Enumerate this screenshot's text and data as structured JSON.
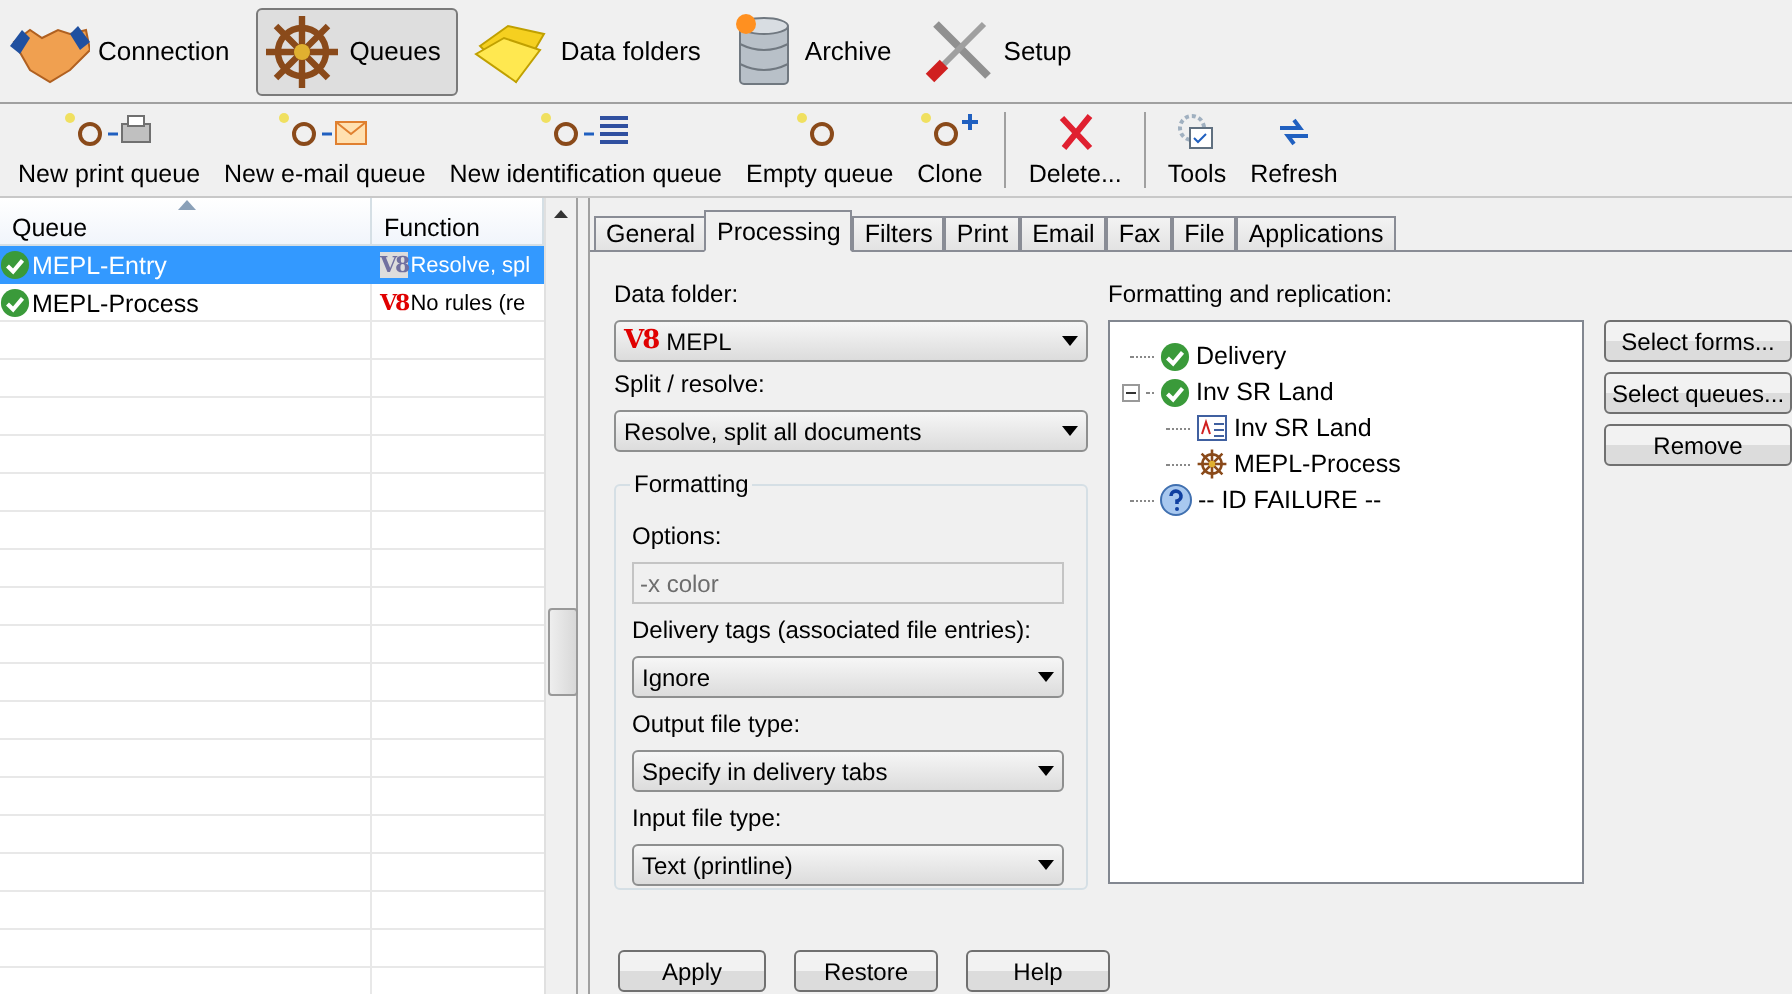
{
  "nav": [
    {
      "label": "Connection",
      "kind": "handshake",
      "selected": false
    },
    {
      "label": "Queues",
      "kind": "wheel",
      "selected": true
    },
    {
      "label": "Data folders",
      "kind": "folder",
      "selected": false
    },
    {
      "label": "Archive",
      "kind": "database",
      "selected": false
    },
    {
      "label": "Setup",
      "kind": "tools",
      "selected": false
    }
  ],
  "toolbar": [
    [
      {
        "label": "New print queue",
        "kind": "print"
      },
      {
        "label": "New e-mail queue",
        "kind": "email"
      },
      {
        "label": "New identification queue",
        "kind": "identify"
      },
      {
        "label": "Empty queue",
        "kind": "empty"
      },
      {
        "label": "Clone",
        "kind": "clone"
      }
    ],
    [
      {
        "label": "Delete...",
        "kind": "delete"
      }
    ],
    [
      {
        "label": "Tools",
        "kind": "settings"
      },
      {
        "label": "Refresh",
        "kind": "refresh"
      }
    ]
  ],
  "queue_table": {
    "columns": [
      {
        "label": "Queue",
        "sorted": true
      },
      {
        "label": "Function",
        "sorted": false
      }
    ],
    "rows": [
      {
        "name": "MEPL-Entry",
        "tag": "V8",
        "function": "Resolve, spl",
        "selected": true
      },
      {
        "name": "MEPL-Process",
        "tag": "V8",
        "function": "No rules (re",
        "selected": false
      }
    ]
  },
  "tabs": [
    {
      "label": "General",
      "selected": false
    },
    {
      "label": "Processing",
      "selected": true
    },
    {
      "label": "Filters",
      "selected": false
    },
    {
      "label": "Print",
      "selected": false
    },
    {
      "label": "Email",
      "selected": false
    },
    {
      "label": "Fax",
      "selected": false
    },
    {
      "label": "File",
      "selected": false
    },
    {
      "label": "Applications",
      "selected": false
    }
  ],
  "processing": {
    "data_folder": {
      "label": "Data folder:",
      "tag": "V8",
      "value": "MEPL"
    },
    "split_resolve": {
      "label": "Split / resolve:",
      "value": "Resolve, split all documents"
    },
    "formatting": {
      "title": "Formatting",
      "options": {
        "label": "Options:",
        "placeholder": "-x color",
        "disabled": true
      },
      "fields": [
        {
          "label": "Delivery tags (associated file entries):",
          "value": "Ignore"
        },
        {
          "label": "Output file type:",
          "value": "Specify in delivery tabs"
        },
        {
          "label": "Input file type:",
          "value": "Text (printline)"
        }
      ]
    },
    "replication": {
      "label": "Formatting and replication:",
      "tree": [
        {
          "label": "Delivery",
          "kind": "ok"
        },
        {
          "label": "Inv SR Land",
          "kind": "ok",
          "expanded": true,
          "children": [
            {
              "label": "Inv SR Land",
              "kind": "form"
            },
            {
              "label": "MEPL-Process",
              "kind": "queue"
            }
          ]
        },
        {
          "label": "-- ID FAILURE --",
          "kind": "unknown"
        }
      ]
    },
    "side_buttons": [
      "Select forms...",
      "Select queues...",
      "Remove"
    ]
  },
  "buttons": [
    "Apply",
    "Restore",
    "Help"
  ]
}
